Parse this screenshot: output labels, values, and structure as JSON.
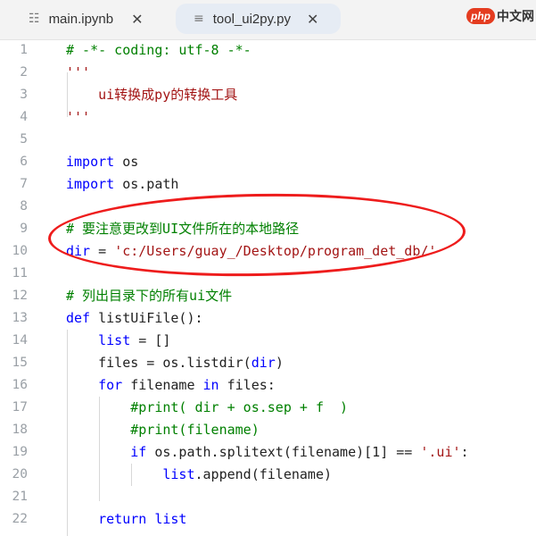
{
  "tabs": [
    {
      "icon": "notebook-icon",
      "label": "main.ipynb",
      "active": false
    },
    {
      "icon": "file-lines-icon",
      "label": "tool_ui2py.py",
      "active": true
    }
  ],
  "watermark": {
    "php": "php",
    "cn": "中文网"
  },
  "colors": {
    "keyword": "#0000ff",
    "comment": "#008000",
    "string": "#a31515",
    "annotation": "#ee1c1c",
    "tab_active_bg": "#e6ecf4"
  },
  "editor": {
    "lines": [
      {
        "n": "1",
        "tokens": [
          [
            "c",
            "# -*- coding: utf-8 -*-"
          ]
        ]
      },
      {
        "n": "2",
        "tokens": [
          [
            "s",
            "'''"
          ]
        ]
      },
      {
        "n": "3",
        "tokens": [
          [
            "s",
            "    ui转换成py的转换工具"
          ]
        ]
      },
      {
        "n": "4",
        "tokens": [
          [
            "s",
            "'''"
          ]
        ]
      },
      {
        "n": "5",
        "tokens": []
      },
      {
        "n": "6",
        "tokens": [
          [
            "k",
            "import"
          ],
          [
            "t",
            " os"
          ]
        ]
      },
      {
        "n": "7",
        "tokens": [
          [
            "k",
            "import"
          ],
          [
            "t",
            " os.path"
          ]
        ]
      },
      {
        "n": "8",
        "tokens": []
      },
      {
        "n": "9",
        "tokens": [
          [
            "c",
            "# 要注意更改到UI文件所在的本地路径"
          ]
        ]
      },
      {
        "n": "10",
        "tokens": [
          [
            "k",
            "dir"
          ],
          [
            "t",
            " = "
          ],
          [
            "s",
            "'c:/Users/guay_/Desktop/program_det_db/'"
          ]
        ]
      },
      {
        "n": "11",
        "tokens": []
      },
      {
        "n": "12",
        "tokens": [
          [
            "c",
            "# 列出目录下的所有ui文件"
          ]
        ]
      },
      {
        "n": "13",
        "tokens": [
          [
            "k",
            "def"
          ],
          [
            "t",
            " listUiFile():"
          ]
        ]
      },
      {
        "n": "14",
        "tokens": [
          [
            "t",
            "    "
          ],
          [
            "k",
            "list"
          ],
          [
            "t",
            " = []"
          ]
        ]
      },
      {
        "n": "15",
        "tokens": [
          [
            "t",
            "    files = os.listdir("
          ],
          [
            "k",
            "dir"
          ],
          [
            "t",
            ")"
          ]
        ]
      },
      {
        "n": "16",
        "tokens": [
          [
            "t",
            "    "
          ],
          [
            "k",
            "for"
          ],
          [
            "t",
            " filename "
          ],
          [
            "k",
            "in"
          ],
          [
            "t",
            " files:"
          ]
        ]
      },
      {
        "n": "17",
        "tokens": [
          [
            "t",
            "        "
          ],
          [
            "c",
            "#print( dir + os.sep + f  )"
          ]
        ]
      },
      {
        "n": "18",
        "tokens": [
          [
            "t",
            "        "
          ],
          [
            "c",
            "#print(filename)"
          ]
        ]
      },
      {
        "n": "19",
        "tokens": [
          [
            "t",
            "        "
          ],
          [
            "k",
            "if"
          ],
          [
            "t",
            " os.path.splitext(filename)[1] == "
          ],
          [
            "s",
            "'.ui'"
          ],
          [
            "t",
            ":"
          ]
        ]
      },
      {
        "n": "20",
        "tokens": [
          [
            "t",
            "            "
          ],
          [
            "k",
            "list"
          ],
          [
            "t",
            ".append(filename)"
          ]
        ]
      },
      {
        "n": "21",
        "tokens": []
      },
      {
        "n": "22",
        "tokens": [
          [
            "t",
            "    "
          ],
          [
            "k",
            "return"
          ],
          [
            "t",
            " "
          ],
          [
            "k",
            "list"
          ]
        ]
      }
    ]
  }
}
